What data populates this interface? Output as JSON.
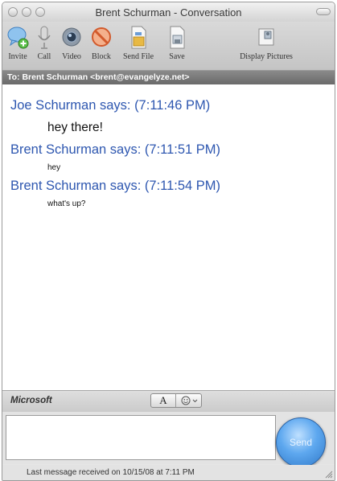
{
  "window": {
    "title": "Brent Schurman - Conversation"
  },
  "toolbar": {
    "items": [
      {
        "label": "Invite",
        "icon": "invite-icon"
      },
      {
        "label": "Call",
        "icon": "microphone-icon"
      },
      {
        "label": "Video",
        "icon": "video-camera-icon"
      },
      {
        "label": "Block",
        "icon": "block-icon"
      },
      {
        "label": "Send File",
        "icon": "send-file-icon"
      },
      {
        "label": "Save",
        "icon": "save-icon"
      },
      {
        "label": "Display Pictures",
        "icon": "display-pictures-icon"
      }
    ]
  },
  "conversation": {
    "to": "To: Brent Schurman <brent@evangelyze.net>",
    "messages": [
      {
        "header": "Joe Schurman says: (7:11:46 PM)",
        "text": "hey there!"
      },
      {
        "header": "Brent Schurman says: (7:11:51 PM)",
        "text": "hey"
      },
      {
        "header": "Brent Schurman says: (7:11:54 PM)",
        "text": "what's up?"
      }
    ]
  },
  "format_bar": {
    "brand": "Microsoft",
    "font_button": "A",
    "emoticon_icon": "smiley-icon"
  },
  "compose": {
    "value": "",
    "send_label": "Send"
  },
  "status": {
    "text": "Last message received on 10/15/08 at 7:11 PM"
  },
  "colors": {
    "sender_header": "#2e57b0",
    "to_bar": "#7a7a7a",
    "send_button": "#4a90e2"
  }
}
